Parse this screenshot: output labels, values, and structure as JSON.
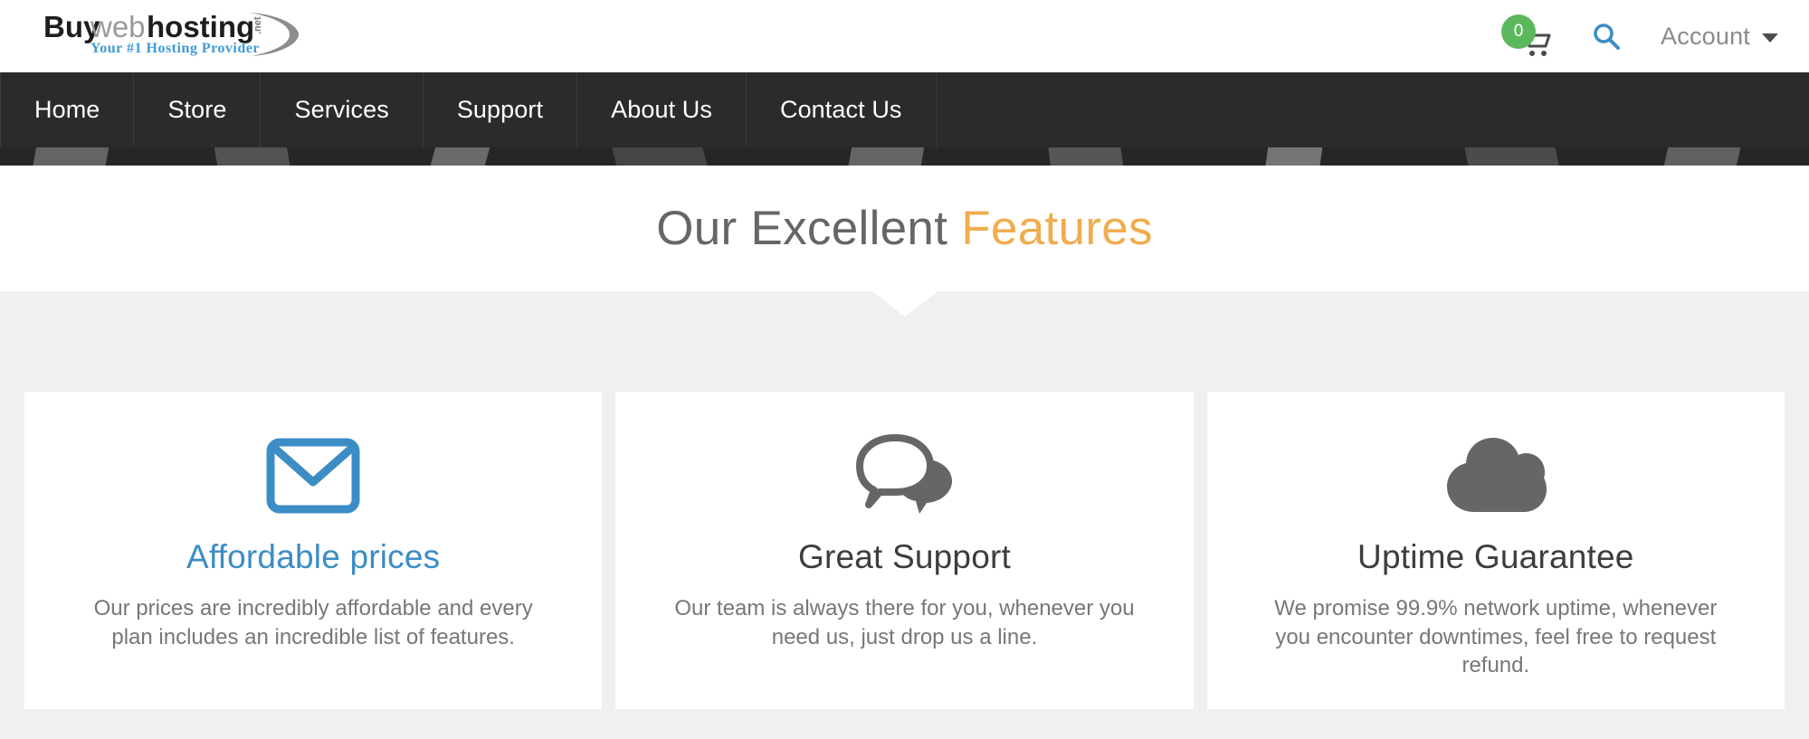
{
  "header": {
    "logo": {
      "name": "buywebhosting-logo",
      "word_one": "Buy",
      "word_two": "web",
      "word_three": "hosting",
      "tld": ".net",
      "tagline": "Your #1 Hosting Provider"
    },
    "cart": {
      "icon": "shopping-cart-icon",
      "count": "0",
      "badge_color": "#5cb85c"
    },
    "search": {
      "icon": "search-icon",
      "color": "#3c8dc5"
    },
    "account": {
      "label": "Account",
      "caret_icon": "chevron-down-icon"
    }
  },
  "nav": {
    "background": "#2b2b2b",
    "items": [
      {
        "label": "Home"
      },
      {
        "label": "Store"
      },
      {
        "label": "Services"
      },
      {
        "label": "Support"
      },
      {
        "label": "About Us"
      },
      {
        "label": "Contact Us"
      }
    ]
  },
  "title_section": {
    "title_plain": "Our Excellent ",
    "title_accent": "Features",
    "accent_color": "#f0ad4e"
  },
  "features": {
    "section_background": "#f1f0f0",
    "cards": [
      {
        "icon": "envelope-icon",
        "icon_color": "#3c8dc5",
        "title": "Affordable prices",
        "title_color": "#3c8dc5",
        "description": "Our prices are incredibly affordable and every plan includes an incredible list of features."
      },
      {
        "icon": "speech-bubbles-icon",
        "icon_color": "#666666",
        "title": "Great Support",
        "title_color": "#3d3d3d",
        "description": "Our team is always there for you, whenever you need us, just drop us a line."
      },
      {
        "icon": "cloud-icon",
        "icon_color": "#666666",
        "title": "Uptime Guarantee",
        "title_color": "#3d3d3d",
        "description": "We promise 99.9% network uptime, whenever you encounter downtimes, feel free to request refund."
      }
    ]
  }
}
